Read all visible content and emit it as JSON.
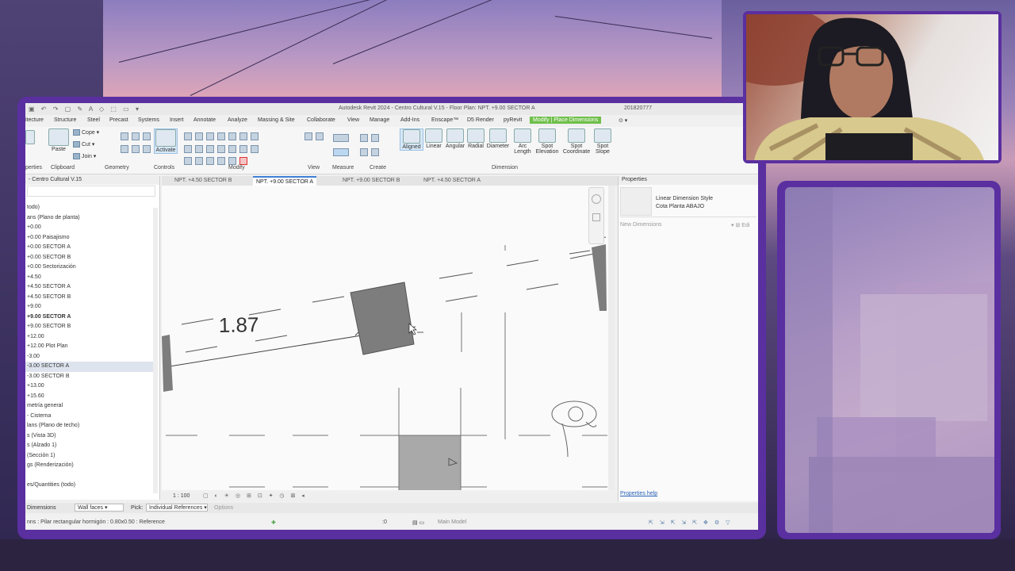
{
  "app": {
    "title": "Autodesk Revit 2024 - Centro Cultural V.15 - Floor Plan: NPT. +9.00 SECTOR A",
    "user": "201820777"
  },
  "ribbon_tabs": [
    "itecture",
    "Structure",
    "Steel",
    "Precast",
    "Systems",
    "Insert",
    "Annotate",
    "Analyze",
    "Massing & Site",
    "Collaborate",
    "View",
    "Manage",
    "Add-Ins",
    "Enscape™",
    "D5 Render",
    "pyRevit",
    "Modify | Place Dimensions"
  ],
  "ribbon": {
    "properties_label": "perties",
    "clipboard": {
      "label": "Clipboard",
      "paste": "Paste",
      "cope": "Cope",
      "cut": "Cut",
      "join": "Join"
    },
    "geometry": {
      "label": "Geometry"
    },
    "controls": {
      "label": "Controls",
      "activate": "Activate"
    },
    "modify": {
      "label": "Modify"
    },
    "view": {
      "label": "View"
    },
    "measure": {
      "label": "Measure"
    },
    "create": {
      "label": "Create"
    },
    "dimension": {
      "label": "Dimension",
      "tools": [
        {
          "line1": "Aligned",
          "line2": ""
        },
        {
          "line1": "Linear",
          "line2": ""
        },
        {
          "line1": "Angular",
          "line2": ""
        },
        {
          "line1": "Radial",
          "line2": ""
        },
        {
          "line1": "Diameter",
          "line2": ""
        },
        {
          "line1": "Arc",
          "line2": "Length"
        },
        {
          "line1": "Spot",
          "line2": "Elevation"
        },
        {
          "line1": "Spot",
          "line2": "Coordinate"
        },
        {
          "line1": "Spot",
          "line2": "Slope"
        }
      ]
    }
  },
  "browser": {
    "title": "- Centro Cultural V.15",
    "items": [
      {
        "text": "todo)",
        "bold": false,
        "selected": false
      },
      {
        "text": "ans (Plano de planta)",
        "bold": false,
        "selected": false
      },
      {
        "text": "+0.00",
        "bold": false,
        "selected": false
      },
      {
        "text": "+0.00 Paisajismo",
        "bold": false,
        "selected": false
      },
      {
        "text": "+0.00 SECTOR A",
        "bold": false,
        "selected": false
      },
      {
        "text": "+0.00 SECTOR B",
        "bold": false,
        "selected": false
      },
      {
        "text": "+0.00 Sectorización",
        "bold": false,
        "selected": false
      },
      {
        "text": "+4.50",
        "bold": false,
        "selected": false
      },
      {
        "text": "+4.50 SECTOR A",
        "bold": false,
        "selected": false
      },
      {
        "text": "+4.50 SECTOR B",
        "bold": false,
        "selected": false
      },
      {
        "text": "+9.00",
        "bold": false,
        "selected": false
      },
      {
        "text": "+9.00 SECTOR A",
        "bold": true,
        "selected": false
      },
      {
        "text": "+9.00 SECTOR B",
        "bold": false,
        "selected": false
      },
      {
        "text": "+12.00",
        "bold": false,
        "selected": false
      },
      {
        "text": "+12.00 Plot Plan",
        "bold": false,
        "selected": false
      },
      {
        "text": "-3.00",
        "bold": false,
        "selected": false
      },
      {
        "text": "-3.00 SECTOR A",
        "bold": false,
        "selected": true
      },
      {
        "text": "-3.00 SECTOR B",
        "bold": false,
        "selected": false
      },
      {
        "text": "+13.00",
        "bold": false,
        "selected": false
      },
      {
        "text": "+15.60",
        "bold": false,
        "selected": false
      },
      {
        "text": "metría general",
        "bold": false,
        "selected": false
      },
      {
        "text": "- Cisterna",
        "bold": false,
        "selected": false
      },
      {
        "text": "lans (Plano de techo)",
        "bold": false,
        "selected": false
      },
      {
        "text": "s (Vista 3D)",
        "bold": false,
        "selected": false
      },
      {
        "text": "s (Alzado 1)",
        "bold": false,
        "selected": false
      },
      {
        "text": "(Sección 1)",
        "bold": false,
        "selected": false
      },
      {
        "text": "gs (Renderización)",
        "bold": false,
        "selected": false
      },
      {
        "text": "",
        "bold": false,
        "selected": false
      },
      {
        "text": "es/Quantities (todo)",
        "bold": false,
        "selected": false
      }
    ]
  },
  "view_tabs": [
    {
      "label": "NPT. +4.50 SECTOR B",
      "active": false
    },
    {
      "label": "NPT. +9.00 SECTOR A",
      "active": true
    },
    {
      "label": "NPT. +9.00 SECTOR B",
      "active": false
    },
    {
      "label": "NPT. +4.50 SECTOR A",
      "active": false
    }
  ],
  "canvas": {
    "dimension_value": "1.87"
  },
  "view_control": {
    "scale": "1 : 100"
  },
  "properties": {
    "title": "Properties",
    "type_line1": "Linear Dimension Style",
    "type_line2": "Cota Planta ABAJO",
    "selector": "New Dimensions",
    "edit": "Edi",
    "help": "Properties help"
  },
  "options_bar": {
    "dimensions": "Dimensions",
    "wall_faces": "Wall faces",
    "pick_label": "Pick:",
    "pick_value": "Individual References",
    "options": "Options"
  },
  "status": {
    "message": "nns : Pilar rectangular hormigón : 0.80x0.50 : Reference",
    "zero": ":0",
    "model": "Main Model"
  },
  "colors": {
    "accent_frame": "#5a2fa0",
    "active_tab": "#6fbf4a",
    "column_fill": "#7d7d7d"
  }
}
